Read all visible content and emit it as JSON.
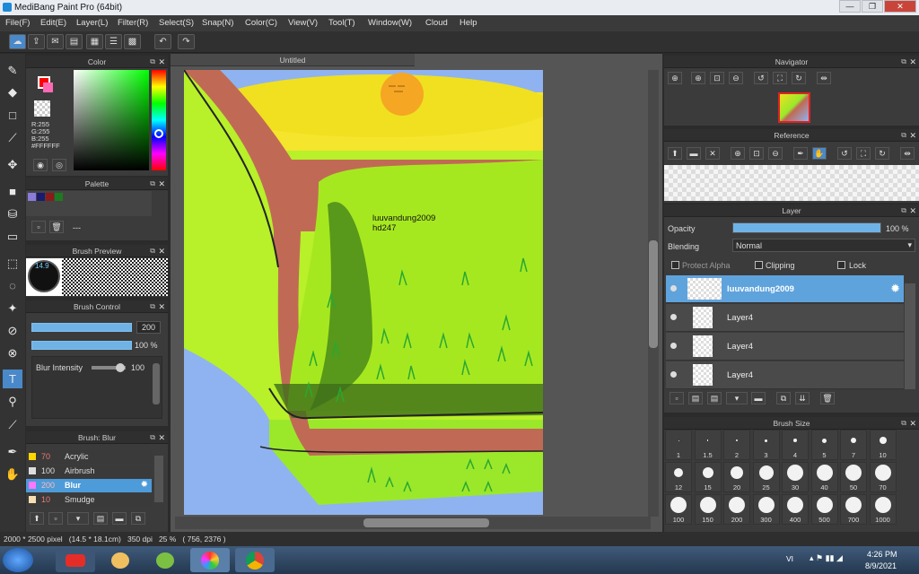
{
  "app": {
    "title": "MediBang Paint Pro (64bit)"
  },
  "menu": [
    "File(F)",
    "Edit(E)",
    "Layer(L)",
    "Filter(R)",
    "Select(S)",
    "Snap(N)",
    "Color(C)",
    "View(V)",
    "Tool(T)",
    "Window(W)",
    "Cloud",
    "Help"
  ],
  "window_controls": {
    "minimize": "—",
    "restore": "❐",
    "close": "✕"
  },
  "canvas": {
    "tab": "Untitled",
    "text_line1": "luuvandung2009",
    "text_line2": "hd247"
  },
  "color_panel": {
    "title": "Color",
    "r": "R:255",
    "g": "G:255",
    "b": "B:255",
    "hex": "#FFFFFF",
    "primary": "#ff0000",
    "secondary": "#ff69b4"
  },
  "palette_panel": {
    "title": "Palette",
    "colors": [
      "#8a7cd8",
      "#1a1a6e",
      "#8b1a1a",
      "#1e7a1e"
    ],
    "name": "---"
  },
  "brush_preview": {
    "title": "Brush Preview",
    "size": "14.9"
  },
  "brush_control": {
    "title": "Brush Control",
    "size_value": "200",
    "opacity_value": "100 %",
    "blur_label": "Blur Intensity",
    "blur_value": "100"
  },
  "brush_list": {
    "title": "Brush: Blur",
    "items": [
      {
        "num": "70",
        "name": "Acrylic",
        "color": "#ffd700"
      },
      {
        "num": "100",
        "name": "Airbrush",
        "color": "#dddddd"
      },
      {
        "num": "200",
        "name": "Blur",
        "color": "#ff77ff"
      },
      {
        "num": "10",
        "name": "Smudge",
        "color": "#f5deb3"
      }
    ]
  },
  "navigator": {
    "title": "Navigator"
  },
  "reference": {
    "title": "Reference"
  },
  "layer_panel": {
    "title": "Layer",
    "opacity_label": "Opacity",
    "opacity_value": "100 %",
    "opacity": 1.0,
    "blending_label": "Blending",
    "blending_value": "Normal",
    "protect_alpha": "Protect Alpha",
    "clipping": "Clipping",
    "lock": "Lock",
    "layers": [
      {
        "name": "luuvandung2009",
        "selected": true
      },
      {
        "name": "Layer4",
        "selected": false
      },
      {
        "name": "Layer4",
        "selected": false
      },
      {
        "name": "Layer4",
        "selected": false
      }
    ]
  },
  "brush_size": {
    "title": "Brush Size",
    "sizes": [
      "1",
      "1.5",
      "2",
      "3",
      "4",
      "5",
      "7",
      "10",
      "12",
      "15",
      "20",
      "25",
      "30",
      "40",
      "50",
      "70",
      "100",
      "150",
      "200",
      "300",
      "400",
      "500",
      "700",
      "1000"
    ]
  },
  "status": {
    "text": "2000 * 2500 pixel   (14.5 * 18.1cm)   350 dpi   25 %   ( 756, 2376 )"
  },
  "taskbar": {
    "lang": "VI",
    "time": "4:26 PM",
    "date": "8/9/2021"
  },
  "icons": [
    "window-icon",
    "undo-icon",
    "redo-icon",
    "pen-icon",
    "eraser-icon",
    "move-icon",
    "fill-icon",
    "text-icon",
    "hand-icon",
    "eyedropper-icon",
    "gear-icon",
    "close-icon"
  ]
}
